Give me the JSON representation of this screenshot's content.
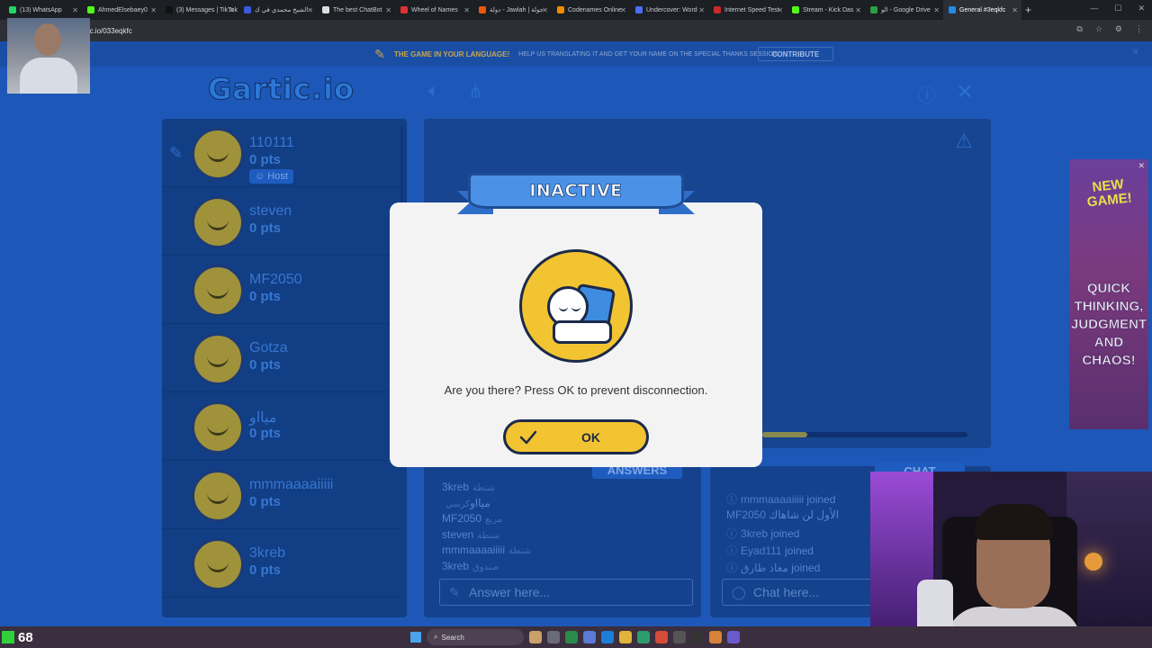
{
  "browser": {
    "tabs": [
      {
        "label": "(13) WhatsApp",
        "color": "#25d366"
      },
      {
        "label": "AhmedElsebaey0",
        "color": "#53fc18"
      },
      {
        "label": "(3) Messages | TikTok",
        "color": "#111111"
      },
      {
        "label": "الشيخ محمدي في ك",
        "color": "#3b5bdb"
      },
      {
        "label": "The best ChatBot",
        "color": "#dddddd"
      },
      {
        "label": "Wheel of Names",
        "color": "#e03131"
      },
      {
        "label": "دولة - Jawlah | جولة",
        "color": "#e8590c"
      },
      {
        "label": "Codenames Online",
        "color": "#f08c00"
      },
      {
        "label": "Undercover: Word",
        "color": "#4c6ef5"
      },
      {
        "label": "Internet Speed Test",
        "color": "#c92a2a"
      },
      {
        "label": "Stream - Kick Das",
        "color": "#53fc18"
      },
      {
        "label": "الو - Google Drive",
        "color": "#2f9e44"
      },
      {
        "label": "General #3eqkfc",
        "color": "#228be6",
        "active": true
      }
    ],
    "url": "gartic.io/033eqkfc",
    "new_tab": "+"
  },
  "banner": {
    "title": "THE GAME IN YOUR LANGUAGE!",
    "subtitle": "HELP US TRANSLATING IT AND GET YOUR NAME ON THE SPECIAL THANKS SESSION",
    "contribute": "CONTRIBUTE"
  },
  "logo": "Gartic.io",
  "players": [
    {
      "name": "110111",
      "pts": "0 pts",
      "host": "Host",
      "drawing": true
    },
    {
      "name": "steven",
      "pts": "0 pts"
    },
    {
      "name": "MF2050",
      "pts": "0 pts"
    },
    {
      "name": "Gotza",
      "pts": "0 pts"
    },
    {
      "name": "ميااو",
      "pts": "0 pts"
    },
    {
      "name": "mmmaaaaiiiii",
      "pts": "0 pts"
    },
    {
      "name": "3kreb",
      "pts": "0 pts"
    }
  ],
  "answers": {
    "header": "ANSWERS",
    "items": [
      {
        "name": "3kreb",
        "text": "شنطة"
      },
      {
        "name": "ميااو",
        "text": "كرسي"
      },
      {
        "name": "MF2050",
        "text": "مربع"
      },
      {
        "name": "steven",
        "text": "شنطة"
      },
      {
        "name": "mmmaaaaiiiii",
        "text": "شنطة"
      },
      {
        "name": "3kreb",
        "text": "صندوق"
      }
    ],
    "placeholder": "Answer here..."
  },
  "chat": {
    "header": "CHAT",
    "items": [
      {
        "name": "mmmaaaaiiiii",
        "text": "joined",
        "icon": true
      },
      {
        "name": "MF2050",
        "text": "الأول لن شاهاك",
        "icon": false
      },
      {
        "name": "3kreb",
        "text": "joined",
        "icon": true
      },
      {
        "name": "Eyad111",
        "text": "joined",
        "icon": true
      },
      {
        "name": "معاذ طارق",
        "text": "joined",
        "icon": true
      }
    ],
    "placeholder": "Chat here..."
  },
  "timer": {
    "progress": 0.22
  },
  "modal": {
    "title": "INACTIVE",
    "message": "Are you there? Press OK to prevent disconnection.",
    "ok": "OK"
  },
  "ad": {
    "headline": "NEW GAME!",
    "text": "QUICK THINKING, JUDGMENT AND CHAOS!"
  },
  "taskbar": {
    "count": "68",
    "search": "Search"
  },
  "colors": {
    "page_bg": "#1d57b7",
    "modal_bg": "#f3f3f3",
    "ribbon": "#4b92e6",
    "ok_button": "#f3c431"
  }
}
